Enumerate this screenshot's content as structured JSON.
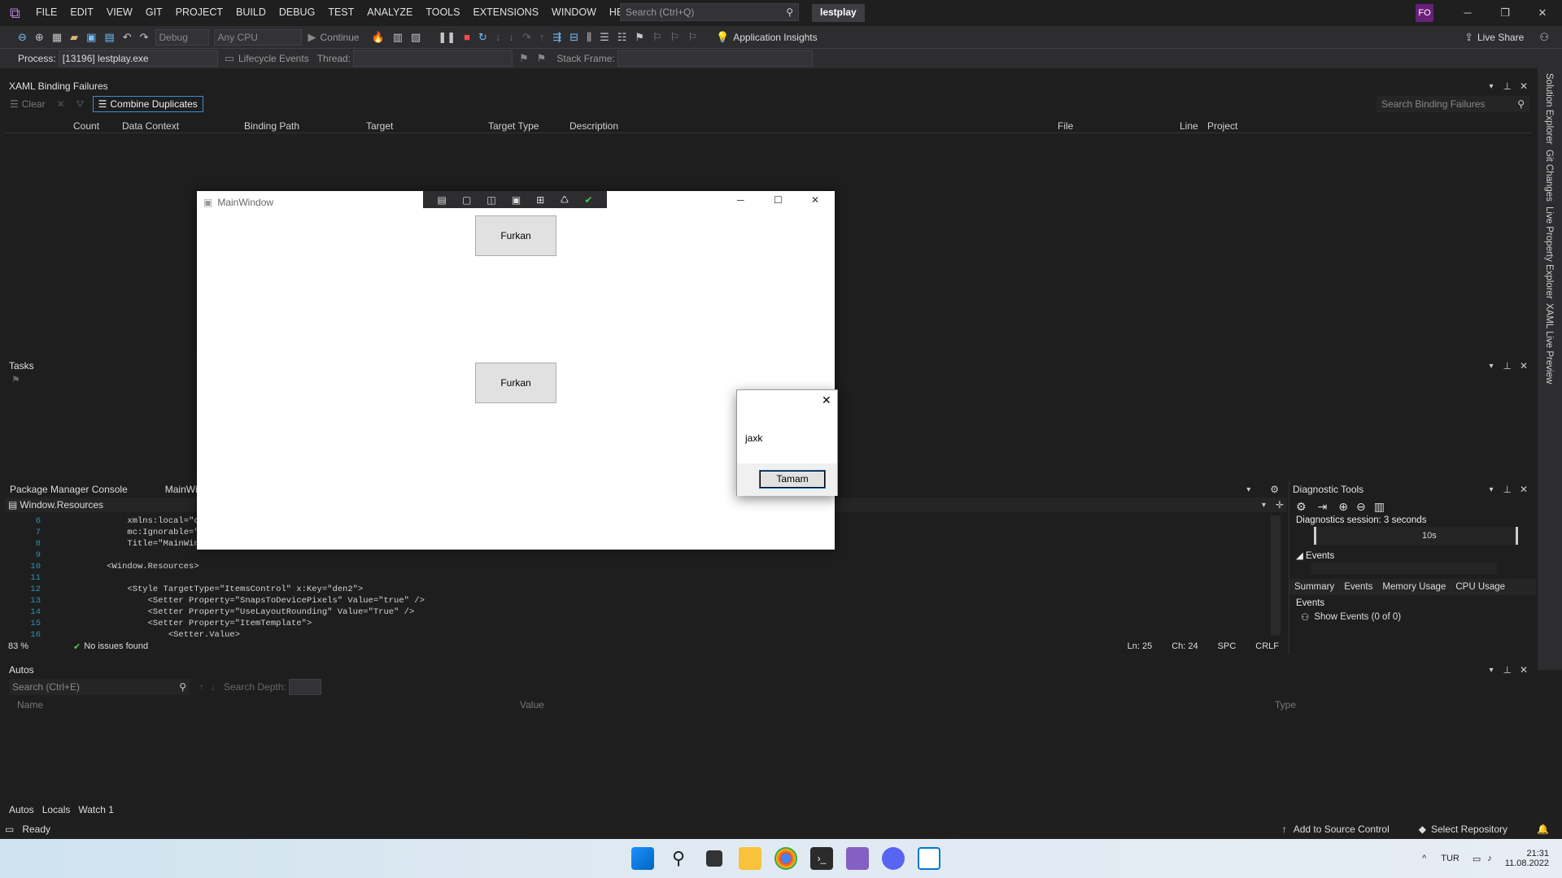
{
  "menu": [
    "FILE",
    "EDIT",
    "VIEW",
    "GIT",
    "PROJECT",
    "BUILD",
    "DEBUG",
    "TEST",
    "ANALYZE",
    "TOOLS",
    "EXTENSIONS",
    "WINDOW",
    "HELP"
  ],
  "search_placeholder": "Search (Ctrl+Q)",
  "solution": "lestplay",
  "avatar": "FO",
  "toolbar": {
    "config": "Debug",
    "platform": "Any CPU",
    "continue": "Continue",
    "app_insights": "Application Insights",
    "live_share": "Live Share"
  },
  "toolbar2": {
    "process_label": "Process:",
    "process_value": "[13196] lestplay.exe",
    "lifecycle": "Lifecycle Events",
    "thread": "Thread:",
    "stack_frame": "Stack Frame:"
  },
  "binding": {
    "title": "XAML Binding Failures",
    "clear": "Clear",
    "combine": "Combine Duplicates",
    "search": "Search Binding Failures",
    "columns": [
      "Count",
      "Data Context",
      "Binding Path",
      "Target",
      "Target Type",
      "Description",
      "File",
      "Line",
      "Project"
    ]
  },
  "tasks": {
    "title": "Tasks"
  },
  "pmc": {
    "tab1": "Package Manager Console",
    "tab2": "MainWi",
    "scope": "Window.Resources"
  },
  "code": [
    {
      "n": "6",
      "t": "        xmlns:local=\"clr-na"
    },
    {
      "n": "7",
      "t": "        mc:Ignorable=\"d\""
    },
    {
      "n": "8",
      "t": "        Title=\"MainWindow\""
    },
    {
      "n": "9",
      "t": ""
    },
    {
      "n": "10",
      "t": "    <Window.Resources>"
    },
    {
      "n": "11",
      "t": ""
    },
    {
      "n": "12",
      "t": "        <Style TargetType=\"ItemsControl\" x:Key=\"den2\">"
    },
    {
      "n": "13",
      "t": "            <Setter Property=\"SnapsToDevicePixels\" Value=\"true\" />"
    },
    {
      "n": "14",
      "t": "            <Setter Property=\"UseLayoutRounding\" Value=\"True\" />"
    },
    {
      "n": "15",
      "t": "            <Setter Property=\"ItemTemplate\">"
    },
    {
      "n": "16",
      "t": "                <Setter.Value>"
    }
  ],
  "editor_status": {
    "zoom": "83 %",
    "issues": "No issues found",
    "ln": "Ln: 25",
    "ch": "Ch: 24",
    "spc": "SPC",
    "crlf": "CRLF"
  },
  "diag": {
    "title": "Diagnostic Tools",
    "session": "Diagnostics session: 3 seconds",
    "tick": "10s",
    "events": "Events",
    "tabs": [
      "Summary",
      "Events",
      "Memory Usage",
      "CPU Usage"
    ],
    "events_header": "Events",
    "show_events": "Show Events (0 of 0)"
  },
  "autos": {
    "title": "Autos",
    "search": "Search (Ctrl+E)",
    "depth": "Search Depth:",
    "cols": [
      "Name",
      "Value",
      "Type"
    ],
    "tabs": [
      "Autos",
      "Locals",
      "Watch 1"
    ]
  },
  "sidetabs": [
    "Solution Explorer",
    "Git Changes",
    "Live Property Explorer",
    "XAML Live Preview"
  ],
  "status": {
    "ready": "Ready",
    "source": "Add to Source Control",
    "repo": "Select Repository"
  },
  "mainwin": {
    "title": "MainWindow",
    "btn1": "Furkan",
    "btn2": "Furkan"
  },
  "msgbox": {
    "text": "jaxk",
    "ok": "Tamam"
  },
  "tray": {
    "lang": "TUR",
    "time": "21:31",
    "date": "11.08.2022"
  }
}
